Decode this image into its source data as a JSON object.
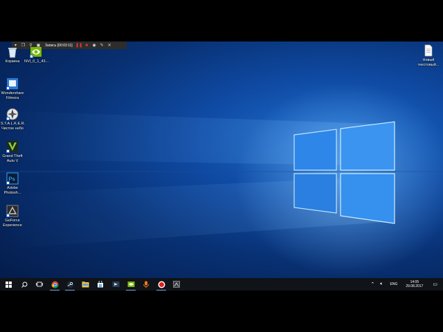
{
  "recorder": {
    "title": "Запись [00:03:11]",
    "buttons": [
      "menu-icon",
      "window-icon",
      "zoom-icon",
      "capture-icon",
      "pause-icon",
      "stop-icon",
      "camera-icon",
      "pen-icon",
      "close-icon"
    ]
  },
  "desktop": {
    "icons": [
      {
        "label": "Корзина",
        "icon": "recycle-bin-icon"
      },
      {
        "label": "NVI_0_1_43...",
        "icon": "nvidia-icon"
      },
      {
        "label": "Wondershare\nFilmora",
        "icon": "filmora-icon"
      },
      {
        "label": "S.T.A.L.K.E.R.\nЧистое небо",
        "icon": "stalker-icon"
      },
      {
        "label": "Grand Theft\nAuto V",
        "icon": "gta-icon"
      },
      {
        "label": "Adobe\nPhotosh...",
        "icon": "photoshop-icon"
      },
      {
        "label": "GeForce\nExperience",
        "icon": "geforce-icon"
      },
      {
        "label": "Новый\nтекстовый...",
        "icon": "text-file-icon"
      }
    ]
  },
  "taskbar": {
    "items": [
      "start-icon",
      "search-icon",
      "task-view-icon",
      "chrome-icon",
      "steam-icon",
      "explorer-icon",
      "store-icon",
      "obs-icon",
      "nvidia-icon",
      "bandicam-icon",
      "record-icon",
      "app-icon"
    ],
    "tray": {
      "language": "ENG",
      "time": "14:05",
      "date": "29.08.2017"
    }
  }
}
